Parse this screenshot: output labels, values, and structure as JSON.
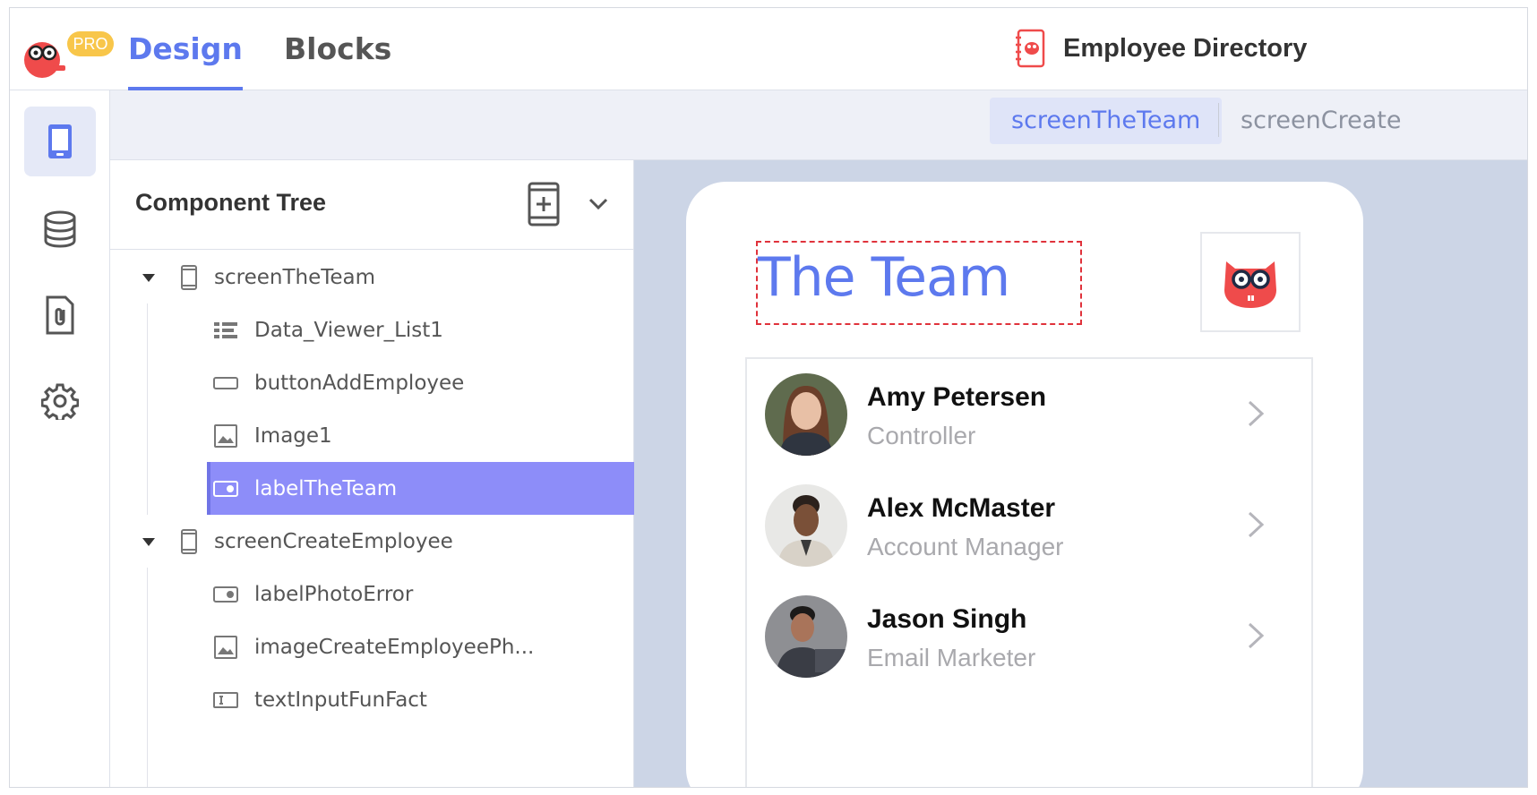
{
  "topbar": {
    "pro_badge": "PRO",
    "tabs": [
      {
        "label": "Design",
        "active": true
      },
      {
        "label": "Blocks",
        "active": false
      }
    ],
    "app_title": "Employee Directory"
  },
  "rail": {
    "items": [
      {
        "icon": "screen-icon",
        "active": true
      },
      {
        "icon": "database-icon",
        "active": false
      },
      {
        "icon": "media-file-icon",
        "active": false
      },
      {
        "icon": "gear-icon",
        "active": false
      }
    ]
  },
  "screen_tabs": [
    {
      "label": "screenTheTeam",
      "active": true
    },
    {
      "label": "screenCreate",
      "active": false
    }
  ],
  "tree": {
    "title": "Component Tree",
    "rows": [
      {
        "label": "screenTheTeam",
        "icon": "screen-icon",
        "level": 0,
        "expanded": true
      },
      {
        "label": "Data_Viewer_List1",
        "icon": "list-icon",
        "level": 1
      },
      {
        "label": "buttonAddEmployee",
        "icon": "button-icon",
        "level": 1
      },
      {
        "label": "Image1",
        "icon": "image-icon",
        "level": 1
      },
      {
        "label": "labelTheTeam",
        "icon": "label-icon",
        "level": 1,
        "selected": true
      },
      {
        "label": "screenCreateEmployee",
        "icon": "screen-icon",
        "level": 0,
        "expanded": true
      },
      {
        "label": "labelPhotoError",
        "icon": "label-icon",
        "level": 1
      },
      {
        "label": "imageCreateEmployeePh...",
        "icon": "image-icon",
        "level": 1
      },
      {
        "label": "textInputFunFact",
        "icon": "text-input-icon",
        "level": 1
      }
    ]
  },
  "preview": {
    "heading": "The Team",
    "employees": [
      {
        "name": "Amy Petersen",
        "title": "Controller"
      },
      {
        "name": "Alex McMaster",
        "title": "Account Manager"
      },
      {
        "name": "Jason Singh",
        "title": "Email Marketer"
      }
    ]
  },
  "colors": {
    "accent": "#5d79ee",
    "selected_row": "#8d8df9",
    "canvas_bg": "#ccd5e6",
    "mascot_red": "#ef4b4b",
    "badge_yellow": "#f8c64a"
  }
}
